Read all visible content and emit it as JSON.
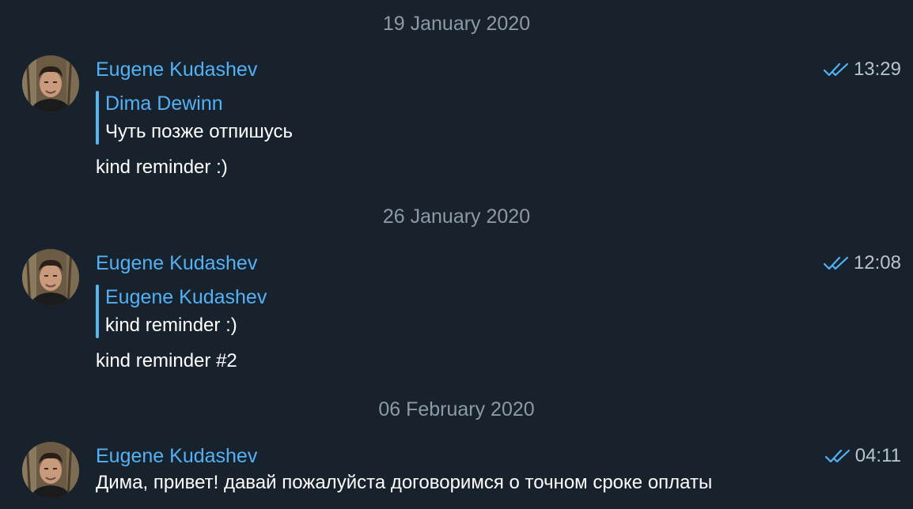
{
  "colors": {
    "background": "#18222d",
    "accent": "#53b1f5",
    "date_text": "#8e99a6",
    "time_text": "#b7c3ce"
  },
  "icons": {
    "read_status": "double-check-icon",
    "avatar": "avatar-photo"
  },
  "messages": [
    {
      "date": "19 January 2020",
      "author": "Eugene Kudashev",
      "time": "13:29",
      "reply": {
        "author": "Dima Dewinn",
        "text": "Чуть позже отпишусь"
      },
      "text": "kind reminder :)"
    },
    {
      "date": "26 January 2020",
      "author": "Eugene Kudashev",
      "time": "12:08",
      "reply": {
        "author": "Eugene Kudashev",
        "text": "kind reminder :)"
      },
      "text": "kind reminder #2"
    },
    {
      "date": "06 February 2020",
      "author": "Eugene Kudashev",
      "time": "04:11",
      "text": "Дима, привет! давай пожалуйста договоримся о точном сроке оплаты"
    }
  ]
}
